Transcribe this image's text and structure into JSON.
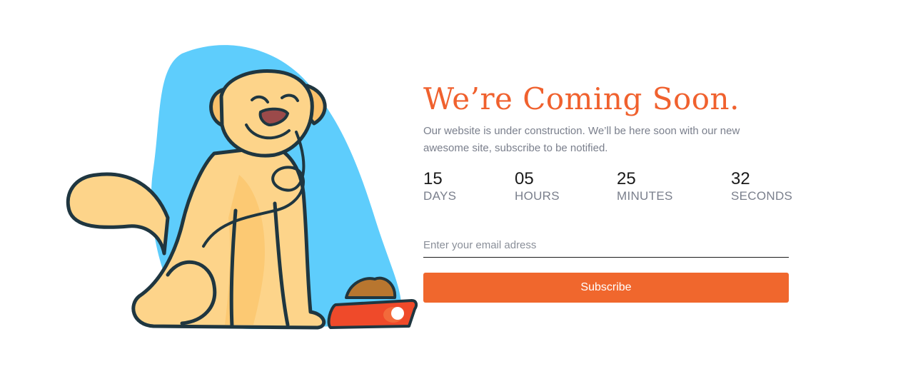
{
  "page": {
    "title": "We’re Coming Soon.",
    "description": "Our website is under construction. We’ll be here soon with our new awesome site, subscribe to be notified."
  },
  "countdown": [
    {
      "value": "15",
      "label": "DAYS"
    },
    {
      "value": "05",
      "label": "HOURS"
    },
    {
      "value": "25",
      "label": "MINUTES"
    },
    {
      "value": "32",
      "label": "SECONDS"
    }
  ],
  "subscribe": {
    "email_placeholder": "Enter your email adress",
    "email_value": "",
    "button_label": "Subscribe"
  },
  "colors": {
    "accent": "#f0612e",
    "button": "#f0672d",
    "blob": "#5ecdfc",
    "dog": "#fdd48a",
    "outline": "#1f3640",
    "bowl": "#ef4a2a"
  },
  "illustration": {
    "icon": "dog-with-food-bowl-illustration"
  }
}
